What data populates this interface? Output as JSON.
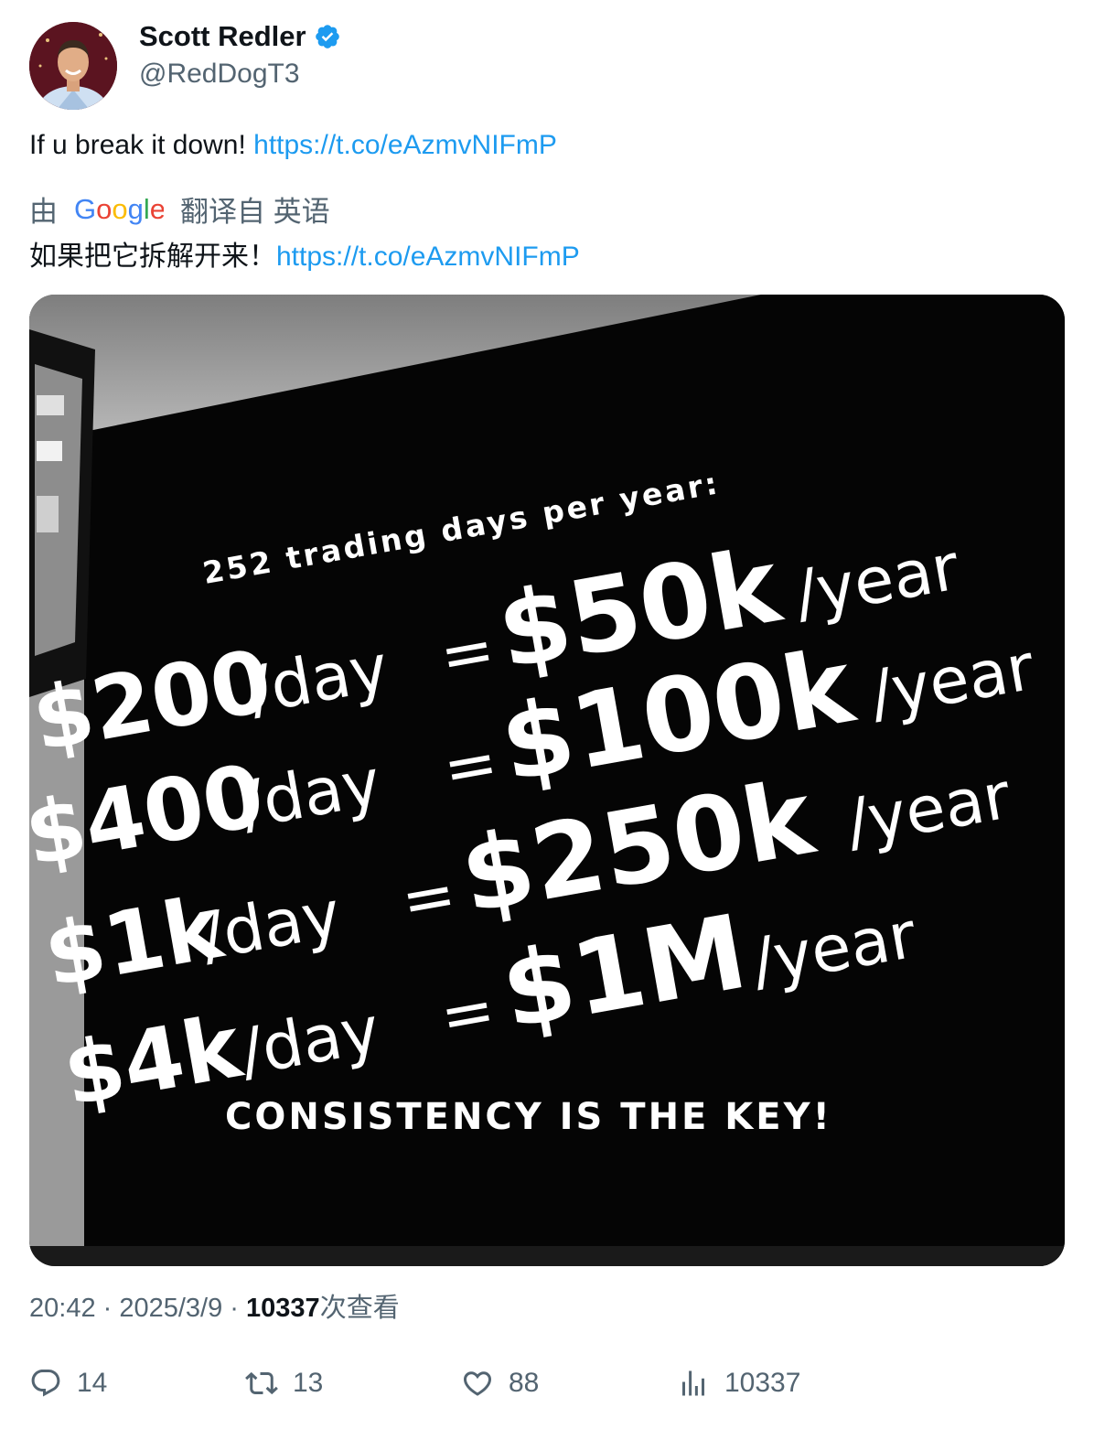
{
  "author": {
    "name": "Scott Redler",
    "handle": "@RedDogT3",
    "verified": true
  },
  "tweet": {
    "text": "If u break it down! ",
    "link": "https://t.co/eAzmvNIFmP"
  },
  "translation": {
    "prefix": "由",
    "provider": "Google",
    "suffix": "翻译自 英语",
    "text": "如果把它拆解开来！",
    "link": "https://t.co/eAzmvNIFmP"
  },
  "image": {
    "header": "252 trading days per year:",
    "rows": [
      {
        "daily": "$200",
        "per_day": "/day",
        "eq": "=",
        "yearly": "$50k",
        "per_year": "/year"
      },
      {
        "daily": "$400",
        "per_day": "/day",
        "eq": "=",
        "yearly": "$100k",
        "per_year": "/year"
      },
      {
        "daily": "$1k",
        "per_day": "/day",
        "eq": "=",
        "yearly": "$250k",
        "per_year": "/year"
      },
      {
        "daily": "$4k",
        "per_day": "/day",
        "eq": "=",
        "yearly": "$1M",
        "per_year": "/year"
      }
    ],
    "footer": "CONSISTENCY IS THE KEY!"
  },
  "meta": {
    "time": "20:42",
    "sep1": " · ",
    "date": "2025/3/9",
    "sep2": " · ",
    "views": "10337",
    "views_label": "次查看"
  },
  "actions": {
    "replies": "14",
    "retweets": "13",
    "likes": "88",
    "views": "10337"
  },
  "colors": {
    "link": "#1d9bf0",
    "verified": "#1d9bf0",
    "secondary_text": "#536471"
  }
}
